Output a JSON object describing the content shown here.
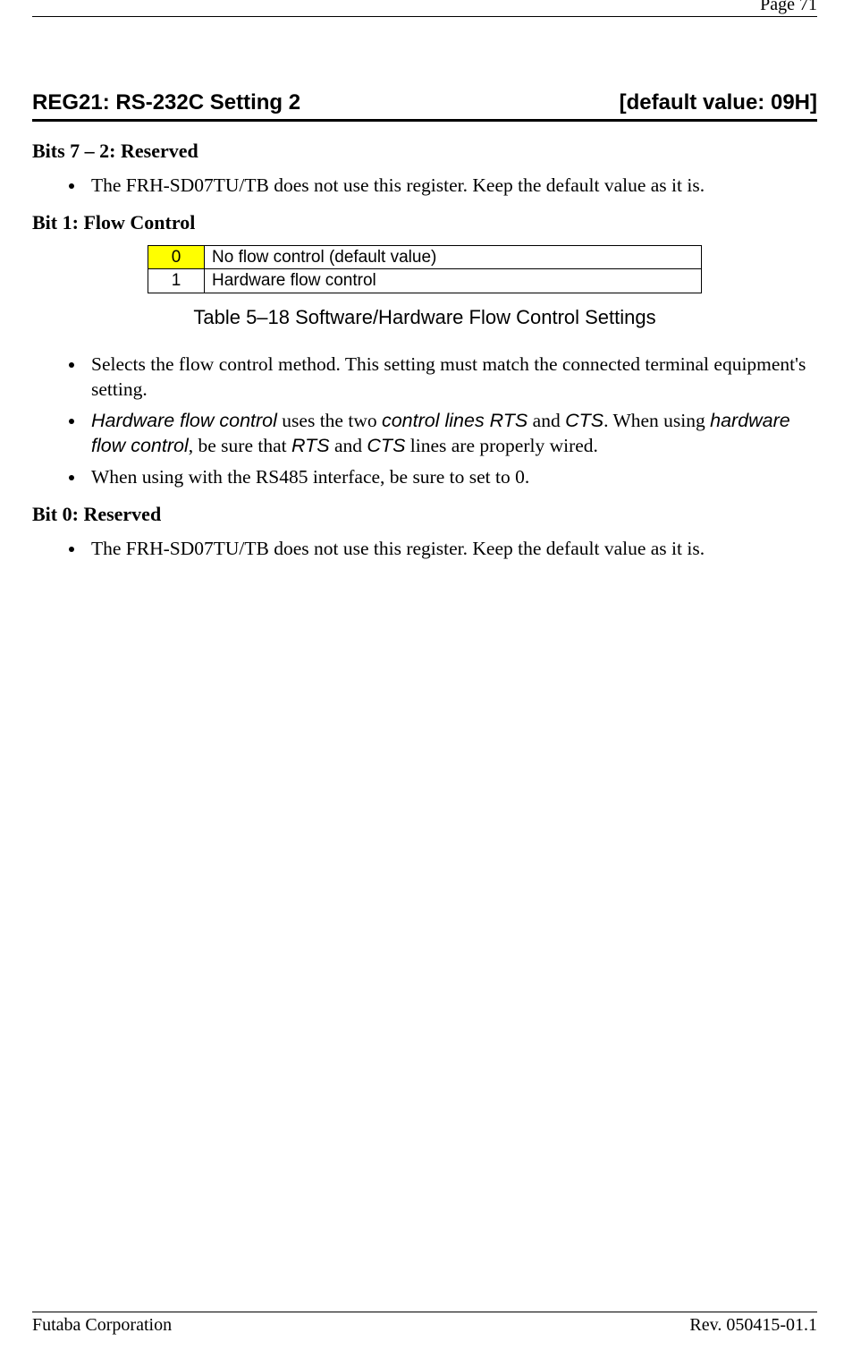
{
  "header": {
    "page_label": "Page  71"
  },
  "section": {
    "title_left": "REG21:  RS-232C Setting 2",
    "title_right": "[default value: 09H]"
  },
  "sub1": {
    "heading": "Bits 7 – 2:  Reserved",
    "bullet1": "The FRH-SD07TU/TB does not use this register. Keep the default value as it is."
  },
  "sub2": {
    "heading": "Bit 1:  Flow Control",
    "table": {
      "rows": [
        {
          "code": "0",
          "desc": "No flow control (default value)"
        },
        {
          "code": "1",
          "desc": "Hardware flow control"
        }
      ]
    },
    "caption": "Table 5–18  Software/Hardware Flow Control Settings",
    "bullet1": "Selects the flow control method. This setting must match the connected terminal equipment's setting.",
    "bullet2": {
      "p1": "Hardware flow control",
      "p2": " uses the two ",
      "p3": "control lines RTS",
      "p4": " and ",
      "p5": "CTS",
      "p6": ". When using ",
      "p7": "hardware flow control",
      "p8": ", be sure that ",
      "p9": "RTS",
      "p10": " and ",
      "p11": "CTS",
      "p12": " lines are properly wired."
    },
    "bullet3": "When using with the RS485 interface, be sure to set to 0."
  },
  "sub3": {
    "heading": "Bit 0:  Reserved",
    "bullet1": "The FRH-SD07TU/TB does not use this register. Keep the default value as it is."
  },
  "footer": {
    "left": "Futaba Corporation",
    "right": "Rev. 050415-01.1"
  }
}
